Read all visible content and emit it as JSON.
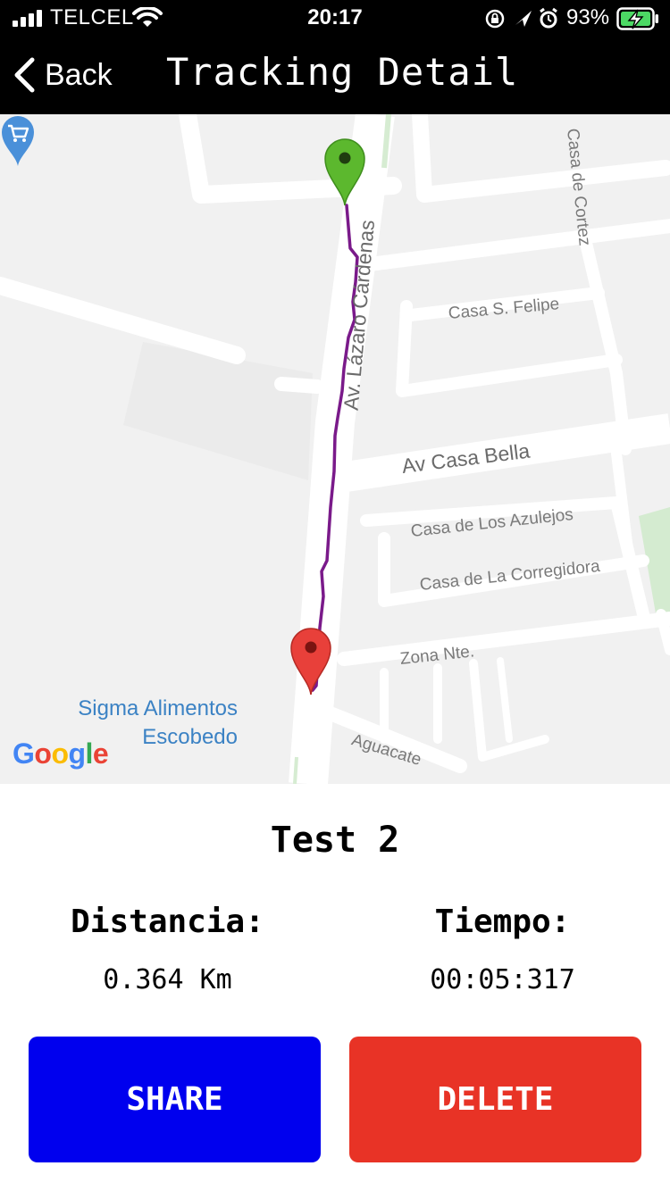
{
  "status_bar": {
    "carrier": "TELCEL",
    "time": "20:17",
    "battery_percent": "93%"
  },
  "nav": {
    "back_label": "Back",
    "title": "Tracking Detail"
  },
  "map": {
    "streets": {
      "lazaro": "Av. Lázaro Cárdenas",
      "casa_cortez": "Casa de Cortez",
      "casa_felipe": "Casa S. Felipe",
      "casa_bella": "Av Casa Bella",
      "azulejos": "Casa de Los Azulejos",
      "corregidora": "Casa de La Corregidora",
      "zona_nte": "Zona Nte.",
      "aguacate": "Aguacate"
    },
    "poi": {
      "line1": "Sigma Alimentos",
      "line2": "Escobedo"
    },
    "logo": "Google",
    "colors": {
      "route": "#7a1a8a",
      "start_marker": "#5cb82e",
      "end_marker": "#e8403a",
      "poi": "#4a90d9"
    }
  },
  "tracking": {
    "name": "Test 2",
    "distance_label": "Distancia:",
    "distance_value": "0.364 Km",
    "time_label": "Tiempo:",
    "time_value": "00:05:317"
  },
  "actions": {
    "share_label": "SHARE",
    "delete_label": "DELETE"
  }
}
